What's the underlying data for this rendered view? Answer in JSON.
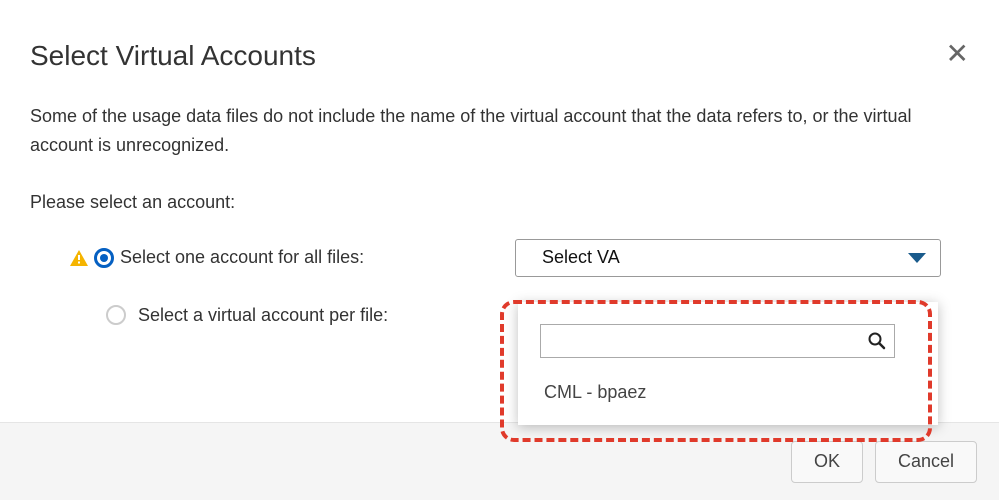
{
  "dialog": {
    "title": "Select Virtual Accounts",
    "description": "Some of the usage data files do not include the name of the virtual account that the data refers to, or the virtual account is unrecognized.",
    "instruction": "Please select an account:",
    "options": {
      "all_files": {
        "label": "Select one account for all files:",
        "selected": true,
        "has_warning": true
      },
      "per_file": {
        "label": "Select a virtual account per file:",
        "selected": false
      }
    },
    "select": {
      "placeholder": "Select VA"
    },
    "dropdown": {
      "search_value": "",
      "items": [
        "CML - bpaez"
      ]
    },
    "buttons": {
      "ok": "OK",
      "cancel": "Cancel"
    }
  }
}
